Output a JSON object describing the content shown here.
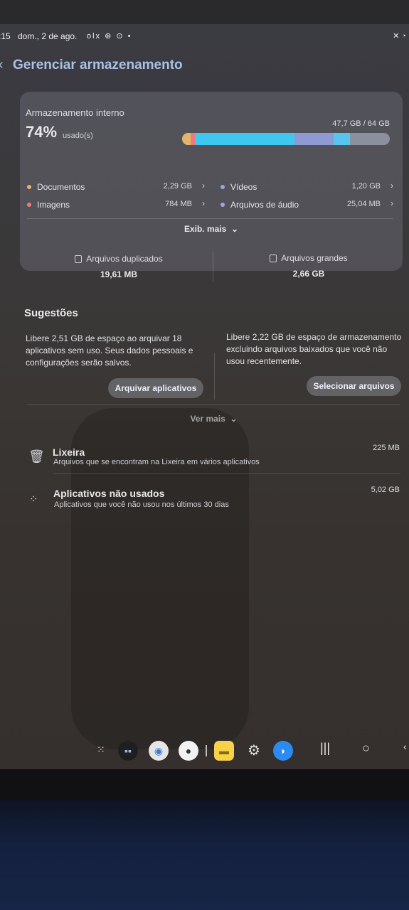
{
  "status_bar": {
    "time": ":15",
    "date": "dom., 2 de ago.",
    "icons": "olx ⊛ ⊙ •",
    "right_icons": "✕ ◔"
  },
  "header": {
    "back_icon": "‹",
    "title": "Gerenciar armazenamento"
  },
  "storage": {
    "label": "Armazenamento interno",
    "percent": "74%",
    "used_label": "usado(s)",
    "total": "47,7 GB / 64 GB",
    "usage_fraction": 0.74,
    "segments": [
      {
        "name": "Documentos",
        "color": "#e3b56a",
        "fraction": 0.04
      },
      {
        "name": "Imagens",
        "color": "#ee7b7b",
        "fraction": 0.02
      },
      {
        "name": "Vídeos",
        "color": "#3ec7ef",
        "fraction": 0.48
      },
      {
        "name": "Arquivos de áudio",
        "color": "#8f9ad4",
        "fraction": 0.19
      },
      {
        "name": "Outros",
        "color": "#58c4f0",
        "fraction": 0.08
      }
    ],
    "categories": [
      {
        "name": "Documentos",
        "size": "2,29 GB",
        "color": "#e3b56a"
      },
      {
        "name": "Vídeos",
        "size": "1,20 GB",
        "color": "#9ea6d8"
      },
      {
        "name": "Imagens",
        "size": "784 MB",
        "color": "#ee7b7b"
      },
      {
        "name": "Arquivos de áudio",
        "size": "25,04 MB",
        "color": "#9ea6d8"
      }
    ],
    "show_more": "Exib. mais",
    "duplicates": {
      "label": "Arquivos duplicados",
      "value": "19,61 MB"
    },
    "large": {
      "label": "Arquivos grandes",
      "value": "2,66 GB"
    }
  },
  "suggestions": {
    "title": "Sugestões",
    "items": [
      {
        "text": "Libere 2,51 GB de espaço ao arquivar 18 aplicativos sem uso. Seus dados pessoais e configurações serão salvos.",
        "button": "Arquivar aplicativos"
      },
      {
        "text": "Libere 2,22 GB de espaço de armazenamento excluindo arquivos baixados que você não usou recentemente.",
        "button": "Selecionar arquivos"
      }
    ],
    "see_more": "Ver mais"
  },
  "rows": [
    {
      "title": "Lixeira",
      "subtitle": "Arquivos que se encontram na Lixeira em vários aplicativos",
      "size": "225 MB",
      "icon": "trash-icon"
    },
    {
      "title": "Aplicativos não usados",
      "subtitle": "Aplicativos que você não usou nos últimos 30 dias",
      "size": "5,02 GB",
      "icon": "apps-icon"
    }
  ]
}
